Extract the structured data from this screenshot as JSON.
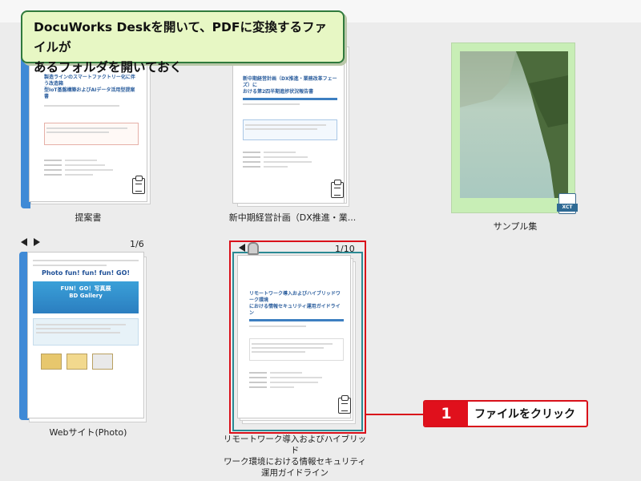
{
  "callout": {
    "line1": "DocuWorks Deskを開いて、PDFに変換するファイルが",
    "line2": "あるフォルダを開いておく"
  },
  "documents": [
    {
      "label": "提案書",
      "preview_title_1": "製造ラインのスマートファクトリー化に伴う改造箱",
      "preview_title_2": "型IoT基盤構築およびAIデータ活用型提案書"
    },
    {
      "label": "新中期経営計画（DX推進・業...",
      "preview_title_1": "新中期経営計画（DX推進・業務改革フェーズ）に",
      "preview_title_2": "おける第2四半期進捗状況報告書"
    },
    {
      "label": "サンプル集",
      "file_badge": "XCT"
    },
    {
      "label": "Webサイト(Photo)",
      "page_count": "1/6",
      "banner_title": "Photo fun! fun! fun! GO!",
      "banner_sub_1": "FUN！GO！写真展",
      "banner_sub_2": "BD Gallery"
    },
    {
      "label_line1": "リモートワーク導入およびハイブリッド",
      "label_line2": "ワーク環境における情報セキュリティ",
      "label_line3": "運用ガイドライン",
      "page_count": "1/10",
      "preview_title_1": "リモートワーク導入およびハイブリッドワーク環境",
      "preview_title_2": "における情報セキュリティ運用ガイドライン"
    }
  ],
  "step": {
    "number": "1",
    "text": "ファイルをクリック"
  },
  "colors": {
    "highlight": "#d9101a",
    "selection": "#2b8a94",
    "callout_bg": "#e7f7c4",
    "spine": "#3f8ad6"
  }
}
